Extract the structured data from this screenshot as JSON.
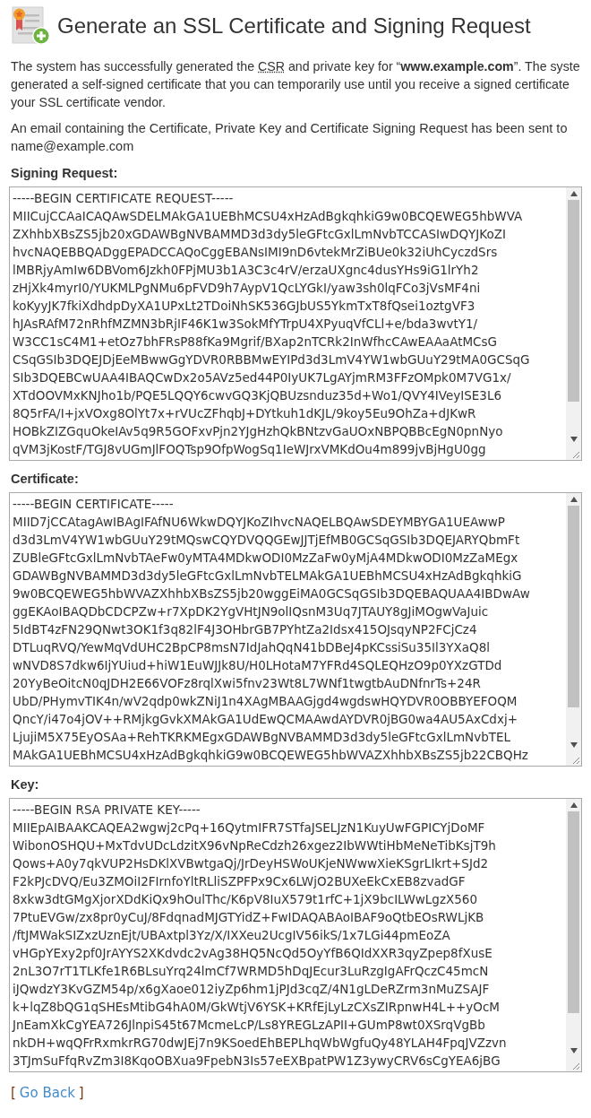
{
  "title": "Generate an SSL Certificate and Signing Request",
  "intro": {
    "lines": [
      {
        "before": "The system has successfully generated the ",
        "abbr": "CSR",
        "after": " and private key for “**www.example.com**”. The syste"
      },
      {
        "before": "generated a self-signed certificate that you can temporarily use until you receive a signed certificate"
      },
      {
        "before": "your SSL certificate vendor."
      }
    ]
  },
  "email_note": "An email containing the Certificate, Private Key and Certificate Signing Request has been sent to name@example.com",
  "sections": [
    {
      "label": "Signing Request:",
      "lines": [
        "-----BEGIN CERTIFICATE REQUEST-----",
        "MIICujCCAaICAQAwSDELMAkGA1UEBhMCSU4xHzAdBgkqhkiG9w0BCQEWEG5hbWVA",
        "ZXhhbXBsZS5jb20xGDAWBgNVBAMMD3d3dy5leGFtcGxlLmNvbTCCASIwDQYJKoZI",
        "hvcNAQEBBQADggEPADCCAQoCggEBANsIMI9nD6vtekMrZiBUe0k32iUhCyczdSrs",
        "lMBRjyAmIw6DBVom6Jzkh0FPjMU3b1A3C3c4rV/erzaUXgnc4dusYHs9iG1lrYh2",
        "zHjXk4myrI0/YUKMLPgNMu6pFVD9h7AypV1QcLYGkI/yaw3sh0lqFCo3jVsMF4ni",
        "koKyyJK7fkiXdhdpDyXA1UPxLt2TDoiNhSK536GJbUS5YkmTxT8fQsei1oztgVF3",
        "hJAsRAfM72nRhfMZMN3bRjIF46K1w3SokMfYTrpU4XPyuqVfCLl+e/bda3wvtY1/",
        "W3CC1sC4M1+etOz7bhFRsP88fKa9Mgrif/BXap2nTCRk2InWfhcCAwEAAaAtMCsG",
        "CSqGSIb3DQEJDjEeMBwwGgYDVR0RBBMwEYIPd3d3LmV4YW1wbGUuY29tMA0GCSqG",
        "SIb3DQEBCwUAA4IBAQCwDx2o5AVz5ed44P0IyUK7LgAYjmRM3FFzOMpk0M7VG1x/",
        "XTdOOVMxKNJho1b/PQE5LQQY6cwvGQ3KjQBUzsnduz35d+Wo1/QVY4IVeyISE3L6",
        "8Q5rFA/I+jxVOxg8OlYt7x+rVUcZFhqbJ+DYtkuh1dKJL/9koy5Eu9OhZa+dJKwR",
        "HOBkZIZGquOkeIAv5q9R5GOFxvPjn2YJgHzhQkBNtzvGaUOxNBPQBBcEgN0pnNyo",
        "qVM3jKostF/TGJ8vUGmJlFOQTsp9OfpWogSq1IeWJrxVMKdOu4m899jvBjHgU0gg"
      ]
    },
    {
      "label": "Certificate:",
      "lines": [
        "-----BEGIN CERTIFICATE-----",
        "MIID7jCCAtagAwIBAgIFAfNU6WkwDQYJKoZIhvcNAQELBQAwSDEYMBYGA1UEAwwP",
        "d3d3LmV4YW1wbGUuY29tMQswCQYDVQQGEwJJTjEfMB0GCSqGSIb3DQEJARYQbmFt",
        "ZUBleGFtcGxlLmNvbTAeFw0yMTA4MDkwODI0MzZaFw0yMjA4MDkwODI0MzZaMEgx",
        "GDAWBgNVBAMMD3d3dy5leGFtcGxlLmNvbTELMAkGA1UEBhMCSU4xHzAdBgkqhkiG",
        "9w0BCQEWEG5hbWVAZXhhbXBsZS5jb20wggEiMA0GCSqGSIb3DQEBAQUAA4IBDwAw",
        "ggEKAoIBAQDbCDCPZw+r7XpDK2YgVHtJN9olIQsnM3Uq7JTAUY8gJiMOgwVaJuic",
        "5IdBT4zFN29QNwt3OK1f3q82lF4J3OHbrGB7PYhtZa2Idsx415OJsqyNP2FCjCz4",
        "DTLuqRVQ/YewMqVdUHC2BpCP8msN7IdJahQqN41bDBeJ4pKCssiSu35Il3YXaQ8l",
        "wNVD8S7dkw6IjYUiud+hiW1EuWJJk8U/H0LHotaM7YFRd4SQLEQHzO9p0YXzGTDd",
        "20YyBeOitcN0qJDH2E66VOFz8rqlXwi5fnv23Wt8L7WNf1twgtbAuDNfnrTs+24R",
        "UbD/PHymvTIK4n/wV2qdp0wkZNiJ1n4XAgMBAAGjgd4wgdswHQYDVR0OBBYEFOQM",
        "QncY/i47o4jOV++RMjkgGvkXMAkGA1UdEwQCMAAwdAYDVR0jBG0wa4AU5AxCdxj+",
        "LjujiM5X75EyOSAa+RehTKRKMEgxGDAWBgNVBAMMD3d3dy5leGFtcGxlLmNvbTEL",
        "MAkGA1UEBhMCSU4xHzAdBgkqhkiG9w0BCQEWEG5hbWVAZXhhbXBsZS5jb22CBQHz"
      ]
    },
    {
      "label": "Key:",
      "lines": [
        "-----BEGIN RSA PRIVATE KEY-----",
        "MIIEpAIBAAKCAQEA2wgwj2cPq+16QytmIFR7STfaJSELJzN1KuyUwFGPICYjDoMF",
        "WibonOSHQU+MxTdvUDcLdzitX96vNpReCdzh26xgez2IbWWtiHbMeNeTibKsjT9h",
        "Qows+A0y7qkVUP2HsDKlXVBwtgaQj/JrDeyHSWoUKjeNWwwXieKSgrLIkrt+SJd2",
        "F2kPJcDVQ/Eu3ZMOiI2FIrnfoYltRLliSZPFPx9Cx6LWjO2BUXeEkCxEB8zvadGF",
        "8xkw3dtGMgXjorXDdKiQx9hOulThc/K6pV8IuX579t1rfC+1jX9bcILWwLgzX560",
        "7PtuEVGw/zx8pr0yCuJ/8FdqnadMJGTYidZ+FwIDAQABAoIBAF9oQtbEOsRWLjKB",
        "/ftJMWakSIZxzUznEjt/UBAxtpl3Yz/X/IXXeu2UcgIV56ikS/1x7LGi44pmEoZA",
        "vHGpYExy2pf0JrAYYS2XKdvdc2vAg38HQ5NcQd5OyYfB6QIdXXR3qyZpep8fXusE",
        "2nL3O7rT1TLKfe1R6BLsuYrq24lmCf7WRMD5hDqJEcur3LuRzgIgAFrQczC45mcN",
        "iJQwdzY3KvGZM54p/x6gXaoe012iyZp6hm1jPJd3cqZ/4N1gLDeRZrm3nMuZSAJF",
        "k+lqZ8bQG1qSHEsMtibG4hA0M/GkWtjV6YSK+KRfEjLyLzCXsZIRpnwH4L++yOcM",
        "JnEamXkCgYEA726JlnpiS45t67McmeLcP/Ls8YREGLzAPII+GUmP8wt0XSrqVgBb",
        "nkDH+wqQFrRxmkrRG70dwJEj7n9KSoedEhBEPLhqWbWgfuQy48YLAH4FpqJVZzvn",
        "3TJmSuFfqRvZm3I8KqoOBXua9FpebN3Is57eEXBpatPW1Z3ywyCRV6sCgYEA6jBG"
      ]
    }
  ],
  "go_back": {
    "open": "[",
    "label": "Go Back",
    "close": "]"
  }
}
